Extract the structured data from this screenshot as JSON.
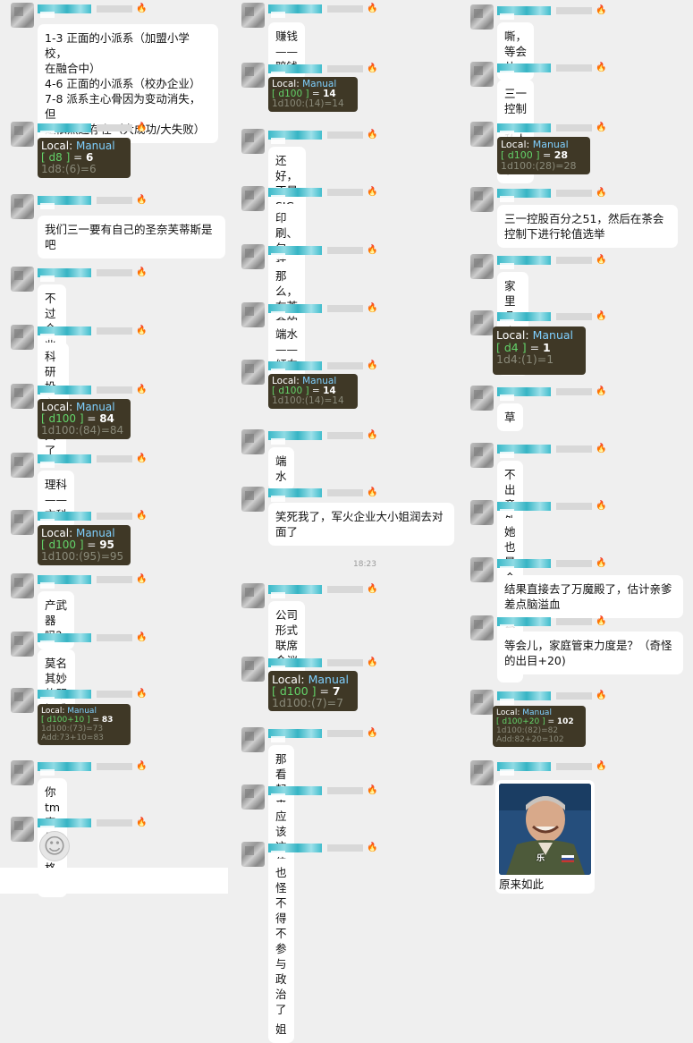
{
  "timestamp": "18:23",
  "columns": {
    "left": [
      {
        "type": "text",
        "text": "1-3 正面的小派系（加盟小学校，\n在融合中）\n4-6 正面的小派系（校办企业）\n7-8 派系主心骨因为变动消失，但\n是依然还存在（大成功/大失败）"
      },
      {
        "type": "dice",
        "line1": "Local: ",
        "manual": "Manual",
        "bracket": "[ d8 ]",
        "eq": " = ",
        "result": "6",
        "line2": "1d8:(6)=6"
      },
      {
        "type": "text",
        "text": "我们三一要有自己的圣奈芙蒂斯是\n吧"
      },
      {
        "type": "text",
        "text": "不过企业50多就不算大了"
      },
      {
        "type": "text",
        "text": "科研投入是?"
      },
      {
        "type": "dice",
        "line1": "Local: ",
        "manual": "Manual",
        "bracket": "[ d100 ]",
        "eq": " = ",
        "result": "84",
        "line2": "1d100:(84)=84"
      },
      {
        "type": "text",
        "text": "理科——文科"
      },
      {
        "type": "dice",
        "line1": "Local: ",
        "manual": "Manual",
        "bracket": "[ d100 ]",
        "eq": " = ",
        "result": "95",
        "line2": "1d100:(95)=95"
      },
      {
        "type": "text",
        "text": "产武器吗？"
      },
      {
        "type": "text",
        "text": "莫名其妙的既视感+10"
      },
      {
        "type": "dice",
        "line1": "Local: ",
        "manual": "Manual",
        "bracket": "[ d100+10 ]",
        "eq": " = ",
        "result": "83",
        "line2": "1d100:(73)=73",
        "line3": "Add:73+10=83"
      },
      {
        "type": "text",
        "text": "你tm真是西格啊"
      },
      {
        "type": "sticker",
        "emoji": "☺"
      }
    ],
    "middle": [
      {
        "type": "text",
        "text": "赚钱——赔钱"
      },
      {
        "type": "dice",
        "line1": "Local: ",
        "manual": "Manual",
        "bracket": "[ d100 ]",
        "eq": " = ",
        "result": "14",
        "line2": "1d100:(14)=14"
      },
      {
        "type": "text",
        "text": "还好，不是SIG USA阶段"
      },
      {
        "type": "text",
        "text": "印刷、包装、工业"
      },
      {
        "type": "text",
        "text": "那么，在茶会的倾向是"
      },
      {
        "type": "text",
        "text": "端水——倾向某派"
      },
      {
        "type": "dice",
        "line1": "Local: ",
        "manual": "Manual",
        "bracket": "[ d100 ]",
        "eq": " = ",
        "result": "14",
        "line2": "1d100:(14)=14"
      },
      {
        "type": "text",
        "text": "端水"
      },
      {
        "type": "text",
        "text": "笑死我了，军火企业大小姐润去对\n面了"
      },
      {
        "type": "text",
        "text": "公司形式\n联席会议——独裁"
      },
      {
        "type": "dice",
        "line1": "Local: ",
        "manual": "Manual",
        "bracket": "[ d100 ]",
        "eq": " = ",
        "result": "7",
        "line2": "1d100:(7)=7"
      },
      {
        "type": "text",
        "text": "那看起来"
      },
      {
        "type": "text",
        "text": "应该这位是其中一个股东的大小姐"
      },
      {
        "type": "text",
        "text": "也怪不得不参与政治了"
      }
    ],
    "right": [
      {
        "type": "text",
        "text": "嘶，等会儿"
      },
      {
        "type": "text",
        "text": "三一控制——私人控股制"
      },
      {
        "type": "dice",
        "line1": "Local: ",
        "manual": "Manual",
        "bracket": "[ d100 ]",
        "eq": " = ",
        "result": "28",
        "line2": "1d100:(28)=28"
      },
      {
        "type": "text",
        "text": "三一控股百分之51，然后在茶会\n控制下进行轮值选举"
      },
      {
        "type": "text",
        "text": "家里几个孩子?"
      },
      {
        "type": "dice",
        "line1": "Local: ",
        "manual": "Manual",
        "bracket": "[ d4 ]",
        "eq": " = ",
        "result": "1",
        "line2": "1d4:(1)=1"
      },
      {
        "type": "text",
        "text": "草"
      },
      {
        "type": "text",
        "text": "不出意外"
      },
      {
        "type": "text",
        "text": "她也是个进茶会的料子"
      },
      {
        "type": "text",
        "text": "结果直接去了万魔殿了，估计亲爹\n差点脑溢血"
      },
      {
        "type": "text",
        "text": "等会儿，家庭管束力度是？（奇怪\n的出目+20)"
      },
      {
        "type": "dice",
        "line1": "Local: ",
        "manual": "Manual",
        "bracket": "[ d100+20 ]",
        "eq": " = ",
        "result": "102",
        "line2": "1d100:(82)=82",
        "line3": "Add:82+20=102"
      },
      {
        "type": "image",
        "photo_caption": "乐",
        "caption": "原来如此"
      }
    ]
  },
  "colors": {
    "background": "#efefef",
    "bubble": "#ffffff",
    "dice_bg": "#3f3826",
    "manual": "#7fd0ff",
    "bracket": "#63d36a",
    "nick": "#38b8c8",
    "flame": "#e8671c"
  },
  "icons": {
    "flame": "flame-icon",
    "avatar": "avatar-blurred"
  }
}
